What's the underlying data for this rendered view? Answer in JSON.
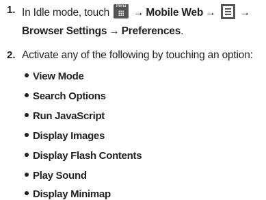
{
  "steps": [
    {
      "number": "1.",
      "line1": {
        "prefix": "In Idle mode, touch",
        "menu_label": "Menu",
        "arrow": "→",
        "item1": "Mobile Web",
        "arrow2": "→",
        "arrow3": "→"
      },
      "line2": {
        "item1": "Browser Settings",
        "arrow": "→",
        "item2": "Preferences",
        "end": "."
      }
    },
    {
      "number": "2.",
      "text": "Activate any of the following by touching an option:"
    }
  ],
  "options": [
    "View Mode",
    "Search Options",
    "Run JavaScript",
    "Display Images",
    "Display Flash Contents",
    "Play Sound",
    "Display Minimap"
  ],
  "icons": {
    "menu_key": "menu-key-icon",
    "options_menu": "options-menu-icon"
  }
}
